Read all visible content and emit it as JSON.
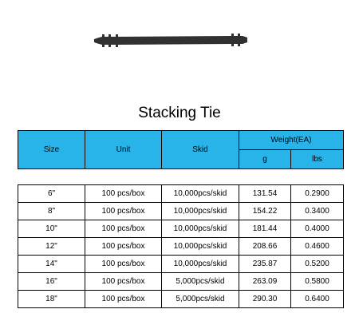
{
  "product": {
    "image_icon": "stacking-tie-strip",
    "title": "Stacking Tie"
  },
  "table": {
    "headers": {
      "size": "Size",
      "unit": "Unit",
      "skid": "Skid",
      "weight": "Weight(EA)",
      "g": "g",
      "lbs": "lbs"
    },
    "rows": [
      {
        "size": "6\"",
        "unit": "100 pcs/box",
        "skid": "10,000pcs/skid",
        "g": "131.54",
        "lbs": "0.2900"
      },
      {
        "size": "8\"",
        "unit": "100 pcs/box",
        "skid": "10,000pcs/skid",
        "g": "154.22",
        "lbs": "0.3400"
      },
      {
        "size": "10\"",
        "unit": "100 pcs/box",
        "skid": "10,000pcs/skid",
        "g": "181.44",
        "lbs": "0.4000"
      },
      {
        "size": "12\"",
        "unit": "100 pcs/box",
        "skid": "10,000pcs/skid",
        "g": "208.66",
        "lbs": "0.4600"
      },
      {
        "size": "14\"",
        "unit": "100 pcs/box",
        "skid": "10,000pcs/skid",
        "g": "235.87",
        "lbs": "0.5200"
      },
      {
        "size": "16\"",
        "unit": "100 pcs/box",
        "skid": "5,000pcs/skid",
        "g": "263.09",
        "lbs": "0.5800"
      },
      {
        "size": "18\"",
        "unit": "100 pcs/box",
        "skid": "5,000pcs/skid",
        "g": "290.30",
        "lbs": "0.6400"
      }
    ],
    "header_color": "#28b4e8"
  }
}
